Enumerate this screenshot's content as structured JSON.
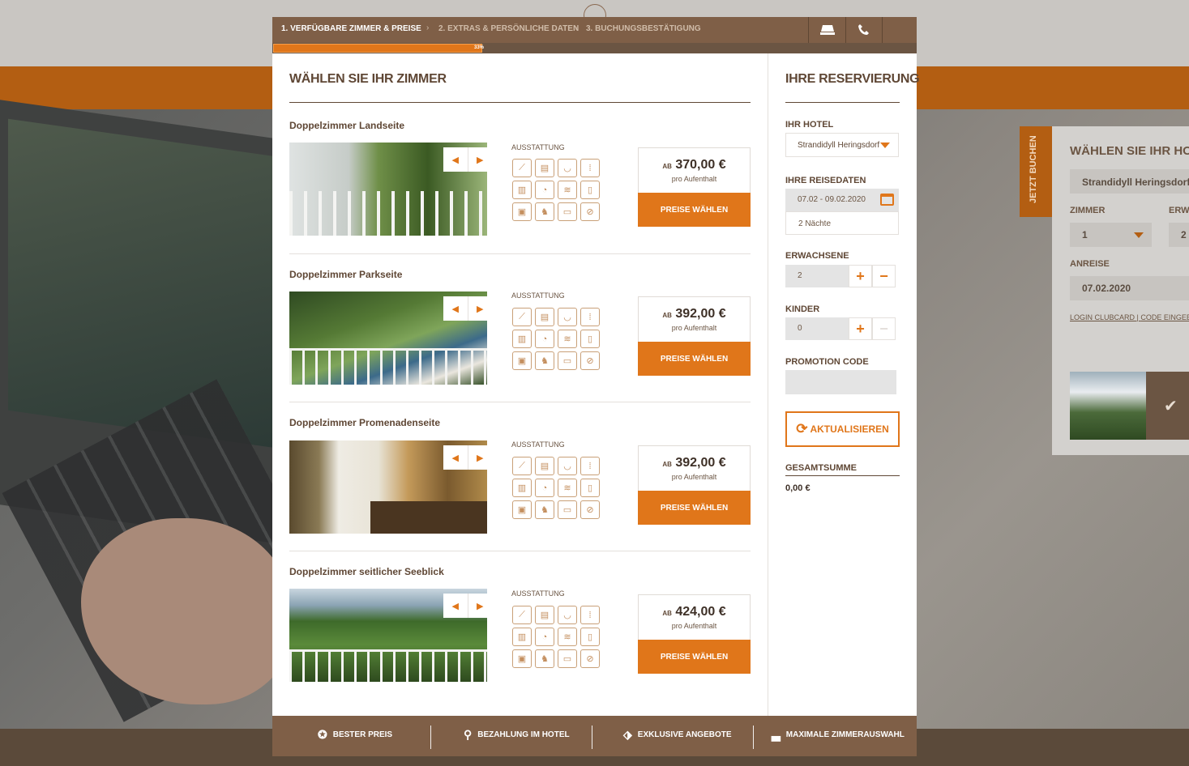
{
  "steps": [
    {
      "label": "1. VERFÜGBARE ZIMMER & PREISE"
    },
    {
      "label": "2. EXTRAS & PERSÖNLICHE DATEN"
    },
    {
      "label": "3. BUCHUNGSBESTÄTIGUNG"
    }
  ],
  "progress": {
    "percent_label": "33%",
    "fraction": 0.33
  },
  "main_title": "WÄHLEN SIE IHR ZIMMER",
  "amenities_label": "AUSSTATTUNG",
  "rooms": [
    {
      "name": "Doppelzimmer Landseite",
      "ab": "AB",
      "price": "370,00 €",
      "sub": "pro Aufenthalt",
      "button": "PREISE WÄHLEN"
    },
    {
      "name": "Doppelzimmer Parkseite",
      "ab": "AB",
      "price": "392,00 €",
      "sub": "pro Aufenthalt",
      "button": "PREISE WÄHLEN"
    },
    {
      "name": "Doppelzimmer Promenadenseite",
      "ab": "AB",
      "price": "392,00 €",
      "sub": "pro Aufenthalt",
      "button": "PREISE WÄHLEN"
    },
    {
      "name": "Doppelzimmer seitlicher Seeblick",
      "ab": "AB",
      "price": "424,00 €",
      "sub": "pro Aufenthalt",
      "button": "PREISE WÄHLEN"
    }
  ],
  "sidebar": {
    "title": "IHRE RESERVIERUNG",
    "hotel_label": "IHR HOTEL",
    "hotel_value": "Strandidyll Heringsdorf",
    "dates_label": "IHRE REISEDATEN",
    "dates_value": "07.02 - 09.02.2020",
    "nights": "2 Nächte",
    "adults_label": "ERWACHSENE",
    "adults_value": "2",
    "children_label": "KINDER",
    "children_value": "0",
    "promo_label": "PROMOTION CODE",
    "update_button": "AKTUALISIEREN",
    "total_label": "GESAMTSUMME",
    "total_value": "0,00 €"
  },
  "footer": [
    {
      "label": "BESTER PREIS",
      "icon": "award-icon"
    },
    {
      "label": "BEZAHLUNG IM HOTEL",
      "icon": "map-pin-icon"
    },
    {
      "label": "EXKLUSIVE ANGEBOTE",
      "icon": "tags-icon"
    },
    {
      "label": "MAXIMALE ZIMMERAUSWAHL",
      "icon": "bed-icon"
    }
  ],
  "background": {
    "tab_label": "JETZT BUCHEN",
    "panel_title": "WÄHLEN SIE IHR HOTE",
    "hotel": "Strandidyll Heringsdorf",
    "zimmer_label": "ZIMMER",
    "zimmer_value": "1",
    "erwa_label": "ERWA",
    "erwa_value": "2",
    "anreise_label": "ANREISE",
    "anreise_value": "07.02.2020",
    "login_link": "LOGIN CLUBCARD",
    "sep": "|",
    "code_link": "CODE EINGEBEN"
  },
  "colors": {
    "brand_brown": "#7f5f47",
    "accent_orange": "#e0761a",
    "text_brown": "#5f4735"
  }
}
